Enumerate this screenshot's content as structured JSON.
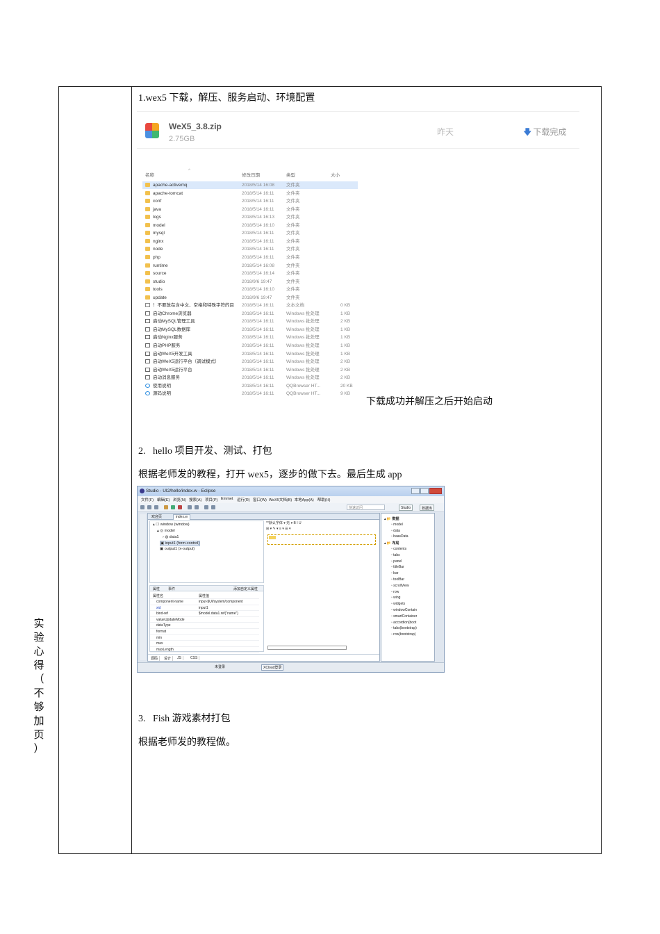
{
  "side_label": [
    "实",
    "验",
    "心",
    "得",
    "（",
    "不",
    "够",
    "加",
    "页",
    "）"
  ],
  "section1": {
    "heading": "1.wex5 下载，解压、服务启动、环境配置",
    "download": {
      "filename": "WeX5_3.8.zip",
      "size": "2.75GB",
      "date": "昨天",
      "status": "下载完成"
    },
    "file_list": {
      "headers": {
        "name": "名称",
        "date": "修改日期",
        "type": "类型",
        "size": "大小"
      },
      "rows": [
        {
          "icon": "folder",
          "name": "apache-activemq",
          "date": "2018/5/14 16:08",
          "type": "文件夹",
          "size": ""
        },
        {
          "icon": "folder",
          "name": "apache-tomcat",
          "date": "2018/5/14 16:11",
          "type": "文件夹",
          "size": ""
        },
        {
          "icon": "folder",
          "name": "conf",
          "date": "2018/5/14 16:11",
          "type": "文件夹",
          "size": ""
        },
        {
          "icon": "folder",
          "name": "java",
          "date": "2018/5/14 16:11",
          "type": "文件夹",
          "size": ""
        },
        {
          "icon": "folder",
          "name": "logs",
          "date": "2018/5/14 16:13",
          "type": "文件夹",
          "size": ""
        },
        {
          "icon": "folder",
          "name": "model",
          "date": "2018/5/14 16:10",
          "type": "文件夹",
          "size": ""
        },
        {
          "icon": "folder",
          "name": "mysql",
          "date": "2018/5/14 16:11",
          "type": "文件夹",
          "size": ""
        },
        {
          "icon": "folder",
          "name": "nginx",
          "date": "2018/5/14 16:11",
          "type": "文件夹",
          "size": ""
        },
        {
          "icon": "folder",
          "name": "node",
          "date": "2018/5/14 16:11",
          "type": "文件夹",
          "size": ""
        },
        {
          "icon": "folder",
          "name": "php",
          "date": "2018/5/14 16:11",
          "type": "文件夹",
          "size": ""
        },
        {
          "icon": "folder",
          "name": "runtime",
          "date": "2018/5/14 16:08",
          "type": "文件夹",
          "size": ""
        },
        {
          "icon": "folder",
          "name": "source",
          "date": "2018/5/14 16:14",
          "type": "文件夹",
          "size": ""
        },
        {
          "icon": "folder",
          "name": "studio",
          "date": "2018/9/6 19:47",
          "type": "文件夹",
          "size": ""
        },
        {
          "icon": "folder",
          "name": "tools",
          "date": "2018/5/14 16:10",
          "type": "文件夹",
          "size": ""
        },
        {
          "icon": "folder",
          "name": "update",
          "date": "2018/9/6 19:47",
          "type": "文件夹",
          "size": ""
        },
        {
          "icon": "text",
          "name": "！不要放在含中文、空格和特殊字符的目",
          "date": "2018/5/14 16:11",
          "type": "文本文档",
          "size": "0 KB"
        },
        {
          "icon": "bat",
          "name": "启动Chrome浏览器",
          "date": "2018/5/14 16:11",
          "type": "Windows 批处理",
          "size": "1 KB"
        },
        {
          "icon": "bat",
          "name": "启动MySQL管理工具",
          "date": "2018/5/14 16:11",
          "type": "Windows 批处理",
          "size": "2 KB"
        },
        {
          "icon": "bat",
          "name": "启动MySQL数据库",
          "date": "2018/5/14 16:11",
          "type": "Windows 批处理",
          "size": "1 KB"
        },
        {
          "icon": "bat",
          "name": "启动Nginx服务",
          "date": "2018/5/14 16:11",
          "type": "Windows 批处理",
          "size": "1 KB"
        },
        {
          "icon": "bat",
          "name": "启动PHP服务",
          "date": "2018/5/14 16:11",
          "type": "Windows 批处理",
          "size": "1 KB"
        },
        {
          "icon": "bat",
          "name": "启动WeX5开发工具",
          "date": "2018/5/14 16:11",
          "type": "Windows 批处理",
          "size": "1 KB"
        },
        {
          "icon": "bat",
          "name": "启动WeX5运行平台（调试模式）",
          "date": "2018/5/14 16:11",
          "type": "Windows 批处理",
          "size": "2 KB"
        },
        {
          "icon": "bat",
          "name": "启动WeX5运行平台",
          "date": "2018/5/14 16:11",
          "type": "Windows 批处理",
          "size": "2 KB"
        },
        {
          "icon": "bat",
          "name": "启动消息服务",
          "date": "2018/5/14 16:11",
          "type": "Windows 批处理",
          "size": "2 KB"
        },
        {
          "icon": "qq",
          "name": "使用说明",
          "date": "2018/5/14 16:11",
          "type": "QQBrowser HT...",
          "size": "20 KB"
        },
        {
          "icon": "qq",
          "name": "源码说明",
          "date": "2018/5/14 16:11",
          "type": "QQBrowser HT...",
          "size": "9 KB"
        }
      ]
    },
    "caption": "下载成功并解压之后开始启动"
  },
  "section2": {
    "heading": "2.   hello 项目开发、测试、打包",
    "body": "根据老师发的教程，打开 wex5，逐步的做下去。最后生成 app",
    "ide": {
      "title": "Studio - UI2/hello/index.w - Eclipse",
      "menu": [
        "文件(F)",
        "编辑(E)",
        "浏览(N)",
        "搜索(A)",
        "项目(P)",
        "Emmet",
        "运行(R)",
        "窗口(W)",
        "WeX5文档(B)",
        "本地App(A)",
        "帮助(H)"
      ],
      "quick_access": "快速访问",
      "perspectives": [
        "Studio",
        "数据库"
      ],
      "tabs": [
        "欢迎页",
        "index.w"
      ],
      "tree": [
        "window (window)",
        "model",
        "data1",
        "input1 (form-control)",
        "output1 (x-output)"
      ],
      "prop_tabs": [
        "属性",
        "事件",
        "添加自定义属性"
      ],
      "prop_headers": {
        "name": "属性名",
        "value": "属性值"
      },
      "props": [
        {
          "name": "component-name",
          "value": "input-$UI/system/component"
        },
        {
          "name": "xid",
          "value": "input1"
        },
        {
          "name": "bind-ref",
          "value": "$model.data1.ref(\"name\")"
        },
        {
          "name": "valueUpdateMode",
          "value": ""
        },
        {
          "name": "dataType",
          "value": ""
        },
        {
          "name": "format",
          "value": ""
        },
        {
          "name": "min",
          "value": ""
        },
        {
          "name": "max",
          "value": ""
        },
        {
          "name": "maxLength",
          "value": ""
        }
      ],
      "bottom_tabs": [
        "源码",
        "设计",
        "JS",
        "CSS"
      ],
      "format_toolbar": "**默认字体 ▾  无 ▾  B  I  U",
      "palette": {
        "data_header": "数据",
        "data": [
          "model",
          "data",
          "baasData"
        ],
        "layout_header": "布局",
        "layout": [
          "contents",
          "tabs",
          "panel",
          "titleBar",
          "bar",
          "toolBar",
          "scrollView",
          "row",
          "wing",
          "widgets",
          "windowContain",
          "smartContainer",
          "accordion(boot",
          "tabs(bootstrap)",
          "row(bootstrap)"
        ]
      },
      "status": {
        "login": "未登录",
        "cloud": "XCloud登录"
      }
    }
  },
  "section3": {
    "heading": "3.   Fish 游戏素材打包",
    "body": "根据老师发的教程做。"
  }
}
